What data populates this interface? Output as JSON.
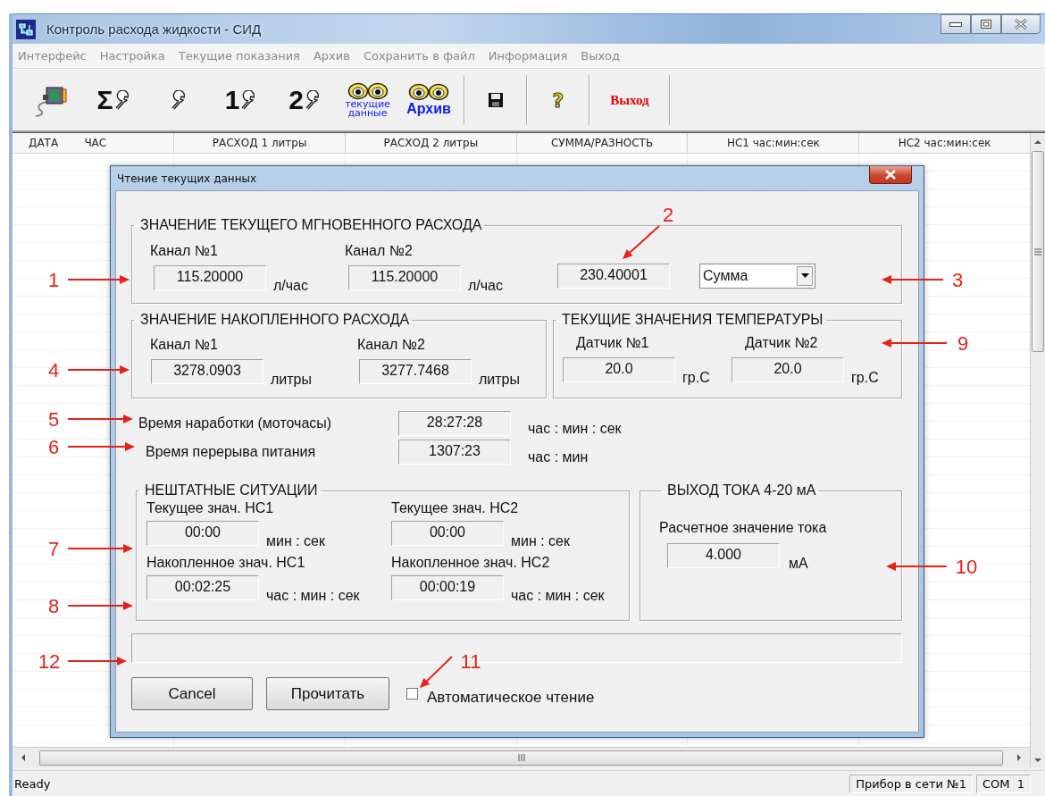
{
  "window": {
    "title": "Контроль расхода жидкости - СИД"
  },
  "menu": [
    "Интерфейс",
    "Настройка",
    "Текущие показания",
    "Архив",
    "Сохранить в файл",
    "Информация",
    "Выход"
  ],
  "toolbar": [
    {
      "kind": "interface"
    },
    {
      "kind": "tool",
      "text": "Σ"
    },
    {
      "kind": "tool"
    },
    {
      "kind": "tool",
      "text": "1"
    },
    {
      "kind": "tool",
      "text": "2"
    },
    {
      "kind": "eyes",
      "lines": [
        "текущие",
        "данные"
      ]
    },
    {
      "kind": "eyes",
      "lines": [
        "Архив"
      ]
    },
    {
      "kind": "separator"
    },
    {
      "kind": "save"
    },
    {
      "kind": "separator"
    },
    {
      "kind": "help",
      "text": "?"
    },
    {
      "kind": "separator"
    },
    {
      "kind": "text",
      "text": "Выход"
    },
    {
      "kind": "separator"
    }
  ],
  "table": {
    "columns": [
      "ДАТА",
      "ЧАС",
      "РАСХОД 1 литры",
      "РАСХОД 2 литры",
      "СУММА/РАЗНОСТЬ",
      "НС1 час:мин:сек",
      "НС2 час:мин:сек"
    ]
  },
  "dialog": {
    "title": "Чтение текущих данных",
    "instant_flow": {
      "legend": "ЗНАЧЕНИЕ ТЕКУЩЕГО МГНОВЕННОГО РАСХОДА",
      "channels": [
        {
          "label": "Канал №1",
          "value": "115.20000",
          "unit": "л/час"
        },
        {
          "label": "Канал №2",
          "value": "115.20000",
          "unit": "л/час"
        }
      ],
      "combined": "230.40001",
      "mode": "Сумма"
    },
    "accumulated": {
      "legend": "ЗНАЧЕНИЕ НАКОПЛЕННОГО РАСХОДА",
      "channels": [
        {
          "label": "Канал №1",
          "value": "3278.0903",
          "unit": "литры"
        },
        {
          "label": "Канал №2",
          "value": "3277.7468",
          "unit": "литры"
        }
      ]
    },
    "temperature": {
      "legend": "ТЕКУЩИЕ ЗНАЧЕНИЯ ТЕМПЕРАТУРЫ",
      "sensors": [
        {
          "label": "Датчик №1",
          "value": "20.0",
          "unit": "гр.С"
        },
        {
          "label": "Датчик №2",
          "value": "20.0",
          "unit": "гр.С"
        }
      ]
    },
    "timers": [
      {
        "label": "Время наработки (моточасы)",
        "value": "28:27:28",
        "unit": "час : мин : сек"
      },
      {
        "label": "Время перерыва питания",
        "value": "1307:23",
        "unit": "час : мин"
      }
    ],
    "faults": {
      "legend": "НЕШТАТНЫЕ СИТУАЦИИ",
      "items": [
        {
          "label": "Текущее знач. НС1",
          "value": "00:00",
          "unit": "мин : сек"
        },
        {
          "label": "Текущее знач. НС2",
          "value": "00:00",
          "unit": "мин : сек"
        },
        {
          "label": "Накопленное знач. НС1",
          "value": "00:02:25",
          "unit": "час : мин : сек"
        },
        {
          "label": "Накопленное знач. НС2",
          "value": "00:00:19",
          "unit": "час : мин : сек"
        }
      ]
    },
    "current_output": {
      "legend": "ВЫХОД ТОКА 4-20 мА",
      "label": "Расчетное значение тока",
      "value": "4.000",
      "unit": "мА"
    },
    "buttons": [
      "Cancel",
      "Прочитать"
    ],
    "auto_read": {
      "label": "Автоматическое чтение",
      "checked": false
    }
  },
  "status_bar": {
    "message": "Ready",
    "panels": [
      "Прибор в сети №1",
      "COM  1"
    ]
  },
  "callouts": [
    "1",
    "2",
    "3",
    "4",
    "5",
    "6",
    "7",
    "8",
    "9",
    "10",
    "11",
    "12"
  ]
}
